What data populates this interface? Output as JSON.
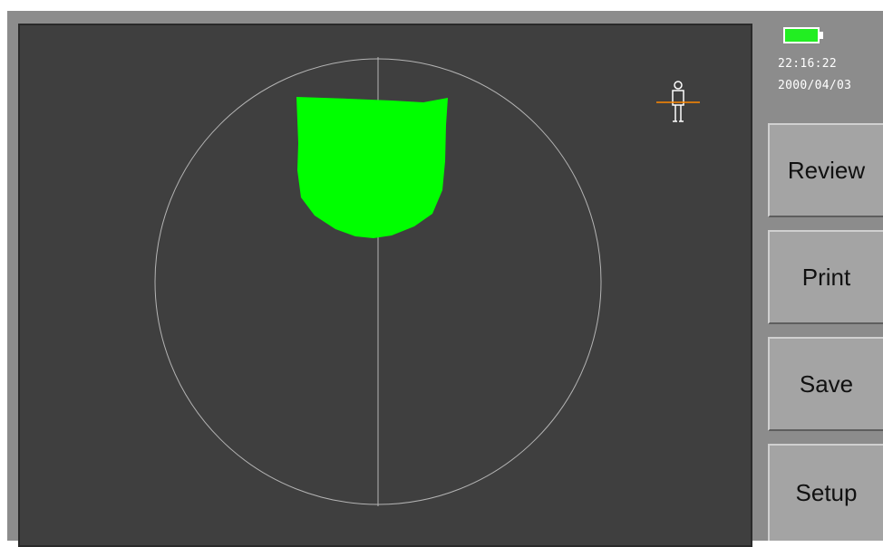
{
  "status": {
    "time": "22:16:22",
    "date": "2000/04/03",
    "battery_icon": "battery-full-icon",
    "battery_color": "#22ee22"
  },
  "menu": {
    "review_label": "Review",
    "print_label": "Print",
    "save_label": "Save",
    "setup_label": "Setup"
  },
  "display": {
    "background_color": "#3f3f3f",
    "circle_color": "#b4b4b4",
    "region_color": "#00ff00",
    "orientation_icon": "patient-orientation-icon",
    "orientation_icon_color": "#ffffff",
    "orientation_line_color": "#ff8800"
  }
}
